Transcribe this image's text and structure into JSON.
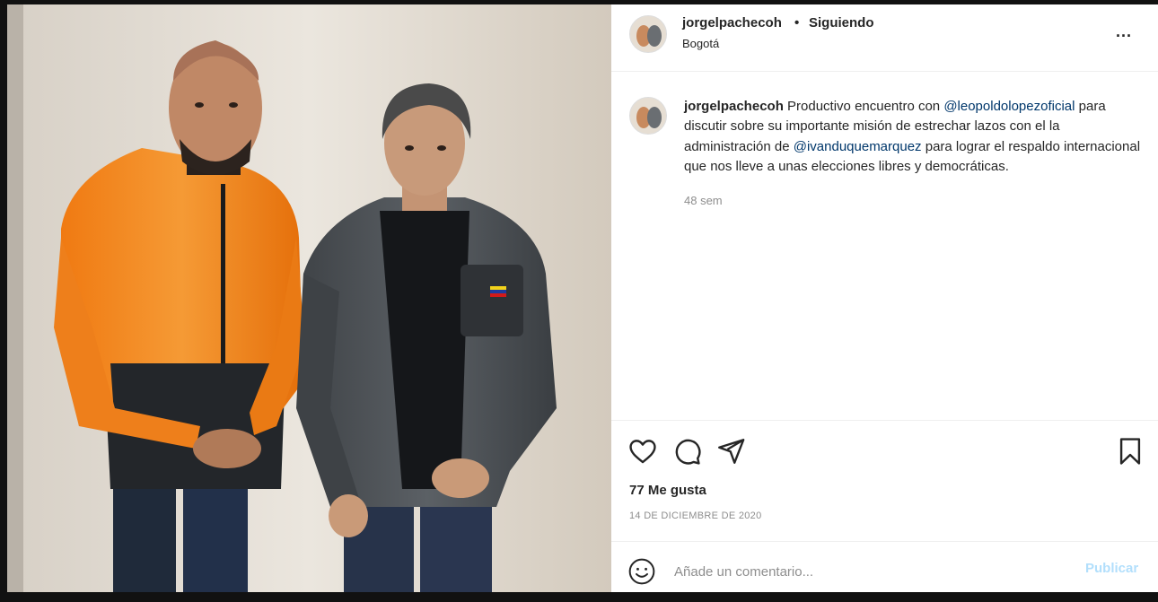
{
  "header": {
    "username": "jorgelpachecoh",
    "separator": "•",
    "follow_status": "Siguiendo",
    "location": "Bogotá",
    "more_label": "..."
  },
  "caption": {
    "username": "jorgelpachecoh",
    "text_1": " Productivo encuentro con ",
    "mention_1": "@leopoldolopezoficial",
    "text_2": " para discutir sobre su importante misión de estrechar lazos con el la administración de ",
    "mention_2": "@ivanduquemarquez",
    "text_3": " para lograr el respaldo internacional que nos lleve a unas elecciones libres y democráticas.",
    "time": "48 sem"
  },
  "actions": {
    "icons": [
      "heart-icon",
      "comment-icon",
      "share-icon",
      "bookmark-icon"
    ]
  },
  "likes": "77 Me gusta",
  "date": "14 DE DICIEMBRE DE 2020",
  "comment": {
    "placeholder": "Añade un comentario...",
    "publish_label": "Publicar"
  },
  "colors": {
    "mention": "#00376b",
    "publish_disabled": "#b2dffc",
    "muted": "#8e8e8e",
    "text": "#262626"
  }
}
